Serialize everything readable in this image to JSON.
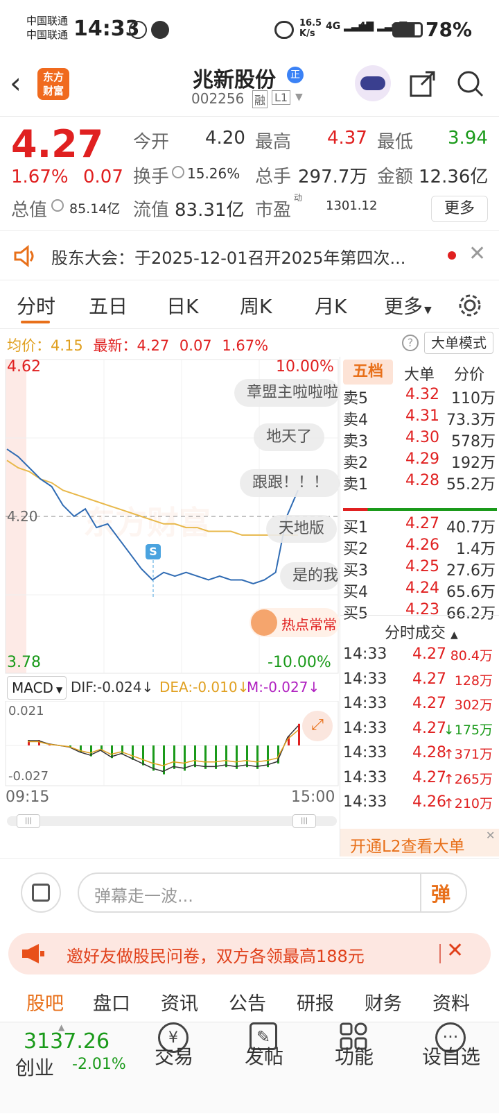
{
  "status": {
    "carrier1": "中国联通",
    "carrier2": "中国联通",
    "time": "14:33",
    "net_speed_top": "16.5",
    "net_speed_unit": "K/s",
    "signal1": "4G",
    "signal2": "4G",
    "battery": "78%"
  },
  "header": {
    "logo_line1": "东方",
    "logo_line2": "财富",
    "stock_name": "兆新股份",
    "badge": "正",
    "code": "002256",
    "margin_tag": "融",
    "level_tag": "L1"
  },
  "quote": {
    "price": "4.27",
    "change_pct": "1.67%",
    "change": "0.07",
    "open_label": "今开",
    "open": "4.20",
    "high_label": "最高",
    "high": "4.37",
    "low_label": "最低",
    "low": "3.94",
    "turnover_label": "换手",
    "turnover": "15.26%",
    "volume_label": "总手",
    "volume": "297.7万",
    "amount_label": "金额",
    "amount": "12.36亿",
    "mktcap_label": "总值",
    "mktcap": "85.14亿",
    "float_label": "流值",
    "float_cap": "83.31亿",
    "pe_label": "市盈",
    "pe_sup": "动",
    "pe": "1301.12",
    "more_button": "更多"
  },
  "notice": {
    "text": "股东大会：于2025-12-01召开2025年第四次..."
  },
  "tabs": [
    "分时",
    "五日",
    "日K",
    "周K",
    "月K",
    "更多"
  ],
  "avg_row": {
    "avg_label": "均价：",
    "avg_value": "4.15",
    "latest_label": "最新：",
    "latest_value": "4.27",
    "latest_change": "0.07",
    "latest_pct": "1.67%",
    "bigorder_button": "大单模式"
  },
  "chart": {
    "y_top": "4.62",
    "y_bottom": "3.78",
    "pct_top": "10.00%",
    "pct_bottom": "-10.00%",
    "ref_price": "4.20",
    "macd_label": "MACD",
    "dif": "DIF:-0.024",
    "dea": "DEA:-0.010",
    "m": "M:-0.027",
    "macd_top": "0.021",
    "macd_bottom": "-0.027",
    "time_start": "09:15",
    "time_end": "15:00",
    "marker_s": "S",
    "hot_label": "热点常常",
    "watermark": "东方财富"
  },
  "chart_data": {
    "type": "line",
    "x": [
      "09:30",
      "09:35",
      "09:40",
      "09:45",
      "09:50",
      "09:55",
      "10:00",
      "10:10",
      "10:20",
      "10:30",
      "10:40",
      "10:50",
      "11:00",
      "11:10",
      "11:20",
      "11:30",
      "13:00",
      "13:15",
      "13:30",
      "13:45",
      "14:00",
      "14:15",
      "14:25",
      "14:28",
      "14:30",
      "14:32",
      "14:33"
    ],
    "series": [
      {
        "name": "最新",
        "values": [
          4.38,
          4.36,
          4.33,
          4.3,
          4.28,
          4.23,
          4.2,
          4.22,
          4.17,
          4.18,
          4.14,
          4.1,
          4.06,
          4.03,
          4.05,
          4.04,
          4.05,
          4.04,
          4.03,
          4.04,
          4.03,
          4.03,
          4.02,
          4.03,
          4.05,
          4.2,
          4.27
        ]
      },
      {
        "name": "均价",
        "values": [
          4.35,
          4.33,
          4.32,
          4.3,
          4.29,
          4.27,
          4.26,
          4.25,
          4.24,
          4.23,
          4.22,
          4.21,
          4.2,
          4.19,
          4.18,
          4.18,
          4.17,
          4.17,
          4.16,
          4.16,
          4.16,
          4.15,
          4.15,
          4.15,
          4.15,
          4.15,
          4.15
        ]
      }
    ],
    "ylim": [
      3.78,
      4.62
    ],
    "ref": 4.2
  },
  "danmaku": [
    "章盟主啦啦啦",
    "地天了",
    "跟跟！！！",
    "天地版",
    "是的我"
  ],
  "five": {
    "tabs": [
      "五档",
      "大单",
      "分价"
    ],
    "sell": [
      {
        "label": "卖5",
        "price": "4.32",
        "vol": "110万"
      },
      {
        "label": "卖4",
        "price": "4.31",
        "vol": "73.3万"
      },
      {
        "label": "卖3",
        "price": "4.30",
        "vol": "578万"
      },
      {
        "label": "卖2",
        "price": "4.29",
        "vol": "192万"
      },
      {
        "label": "卖1",
        "price": "4.28",
        "vol": "55.2万"
      }
    ],
    "buy": [
      {
        "label": "买1",
        "price": "4.27",
        "vol": "40.7万"
      },
      {
        "label": "买2",
        "price": "4.26",
        "vol": "1.4万"
      },
      {
        "label": "买3",
        "price": "4.25",
        "vol": "27.6万"
      },
      {
        "label": "买4",
        "price": "4.24",
        "vol": "65.6万"
      },
      {
        "label": "买5",
        "price": "4.23",
        "vol": "66.2万"
      }
    ]
  },
  "trades": {
    "title": "分时成交",
    "rows": [
      {
        "time": "14:33",
        "price": "4.27",
        "vol": "80.4万",
        "arrow": ""
      },
      {
        "time": "14:33",
        "price": "4.27",
        "vol": "128万",
        "arrow": ""
      },
      {
        "time": "14:33",
        "price": "4.27",
        "vol": "302万",
        "arrow": ""
      },
      {
        "time": "14:33",
        "price": "4.27",
        "vol": "175万",
        "arrow": "↓"
      },
      {
        "time": "14:33",
        "price": "4.28",
        "vol": "371万",
        "arrow": "↑"
      },
      {
        "time": "14:33",
        "price": "4.27",
        "vol": "265万",
        "arrow": "↑"
      },
      {
        "time": "14:33",
        "price": "4.26",
        "vol": "210万",
        "arrow": "↑"
      }
    ],
    "l2_banner": "开通L2查看大单"
  },
  "input": {
    "placeholder": "弹幕走一波...",
    "danmu_button": "弹"
  },
  "promo": {
    "text": "邀好友做股民问卷，双方各领最高188元"
  },
  "bottom_tabs": [
    "股吧",
    "盘口",
    "资讯",
    "公告",
    "研报",
    "财务",
    "资料"
  ],
  "dock": {
    "index_value": "3137.26",
    "index_name": "创业",
    "index_change": "-2.01%",
    "items": [
      "交易",
      "发帖",
      "功能",
      "设自选"
    ]
  }
}
